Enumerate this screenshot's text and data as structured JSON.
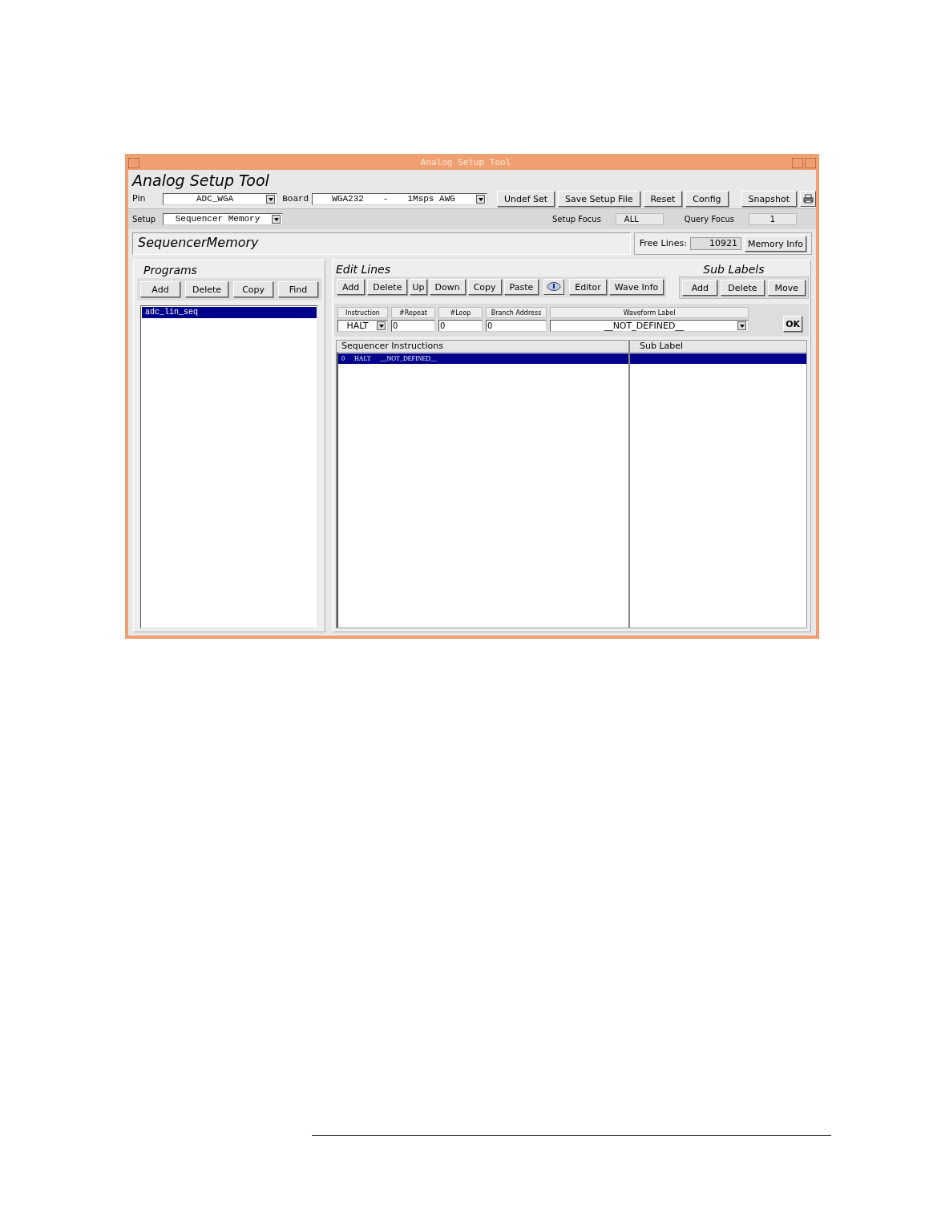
{
  "window": {
    "title": "Analog Setup Tool"
  },
  "app_title": "Analog Setup Tool",
  "pin": {
    "label": "Pin",
    "value": "ADC_WGA"
  },
  "board": {
    "label": "Board",
    "parts": [
      "WGA232",
      "-",
      "1Msps AWG"
    ]
  },
  "toolbar_buttons": [
    {
      "kind": "text",
      "label": "Undef Set"
    },
    {
      "kind": "text",
      "label": "Save Setup File"
    },
    {
      "kind": "text",
      "label": "Reset"
    },
    {
      "kind": "text",
      "label": "Config"
    },
    {
      "kind": "text",
      "label": "Snapshot"
    },
    {
      "kind": "print"
    }
  ],
  "setup": {
    "label": "Setup",
    "value": "Sequencer Memory"
  },
  "setup_focus": {
    "label": "Setup Focus",
    "value": "ALL"
  },
  "query_focus": {
    "label": "Query Focus",
    "value": "1"
  },
  "section_title": "SequencerMemory",
  "free_lines": {
    "label": "Free Lines:",
    "value": "10921"
  },
  "memory_info_button": "Memory Info",
  "programs": {
    "title": "Programs",
    "buttons": [
      "Add",
      "Delete",
      "Copy",
      "Find"
    ],
    "items": [
      {
        "text": "adc_lin_seq",
        "selected": true
      }
    ]
  },
  "edit_lines": {
    "title": "Edit Lines",
    "buttons": [
      {
        "kind": "text",
        "label": "Add"
      },
      {
        "kind": "text",
        "label": "Delete"
      },
      {
        "kind": "text",
        "label": "Up"
      },
      {
        "kind": "text",
        "label": "Down"
      },
      {
        "kind": "text",
        "label": "Copy"
      },
      {
        "kind": "text",
        "label": "Paste"
      },
      {
        "kind": "info"
      },
      {
        "kind": "text",
        "label": "Editor"
      },
      {
        "kind": "text",
        "label": "Wave Info"
      }
    ]
  },
  "sub_labels": {
    "title": "Sub Labels",
    "buttons": [
      "Add",
      "Delete",
      "Move"
    ]
  },
  "fields": [
    {
      "kind": "select",
      "header": "Instruction",
      "value": "HALT"
    },
    {
      "kind": "input",
      "header": "#Repeat",
      "value": "0"
    },
    {
      "kind": "input",
      "header": "#Loop",
      "value": "0"
    },
    {
      "kind": "input",
      "header": "Branch Address",
      "value": "0"
    },
    {
      "kind": "wide-select",
      "header": "Waveform Label",
      "value": "__NOT_DEFINED__"
    }
  ],
  "ok_button": "OK",
  "instruction_list": {
    "header": "Sequencer Instructions",
    "lines": [
      {
        "parts": [
          "0",
          "HALT",
          "__NOT_DEFINED__"
        ],
        "selected": true
      }
    ]
  },
  "sub_label_list": {
    "header": "Sub Label"
  }
}
